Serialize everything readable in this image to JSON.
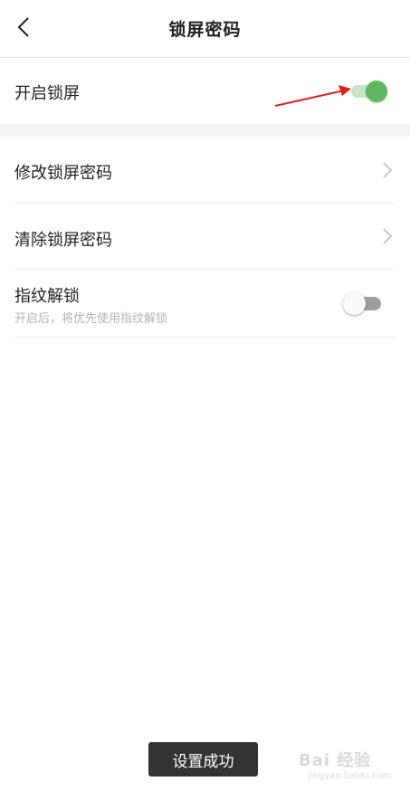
{
  "header": {
    "title": "锁屏密码"
  },
  "rows": {
    "enable_lock": {
      "label": "开启锁屏",
      "enabled": true
    },
    "change_password": {
      "label": "修改锁屏密码"
    },
    "clear_password": {
      "label": "清除锁屏密码"
    },
    "fingerprint": {
      "label": "指纹解锁",
      "description": "开启后，将优先使用指纹解锁",
      "enabled": false
    }
  },
  "toast": {
    "text": "设置成功"
  },
  "watermark": {
    "main": "Bai 经验",
    "sub": "jingyan.baidu.com"
  },
  "colors": {
    "toggle_on": "#5fb85f",
    "toggle_off": "#9e9e9e",
    "arrow": "#e0201e",
    "toast_bg": "#333333"
  }
}
